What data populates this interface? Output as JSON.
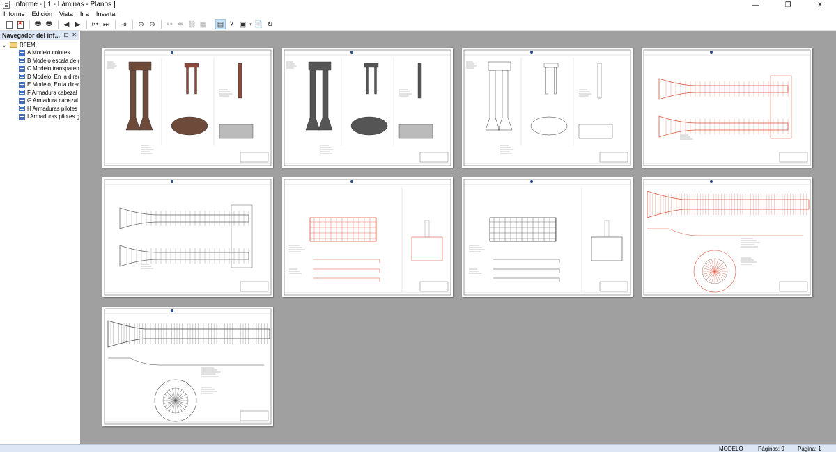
{
  "window": {
    "title": "Informe - [ 1 - Láminas - Planos ]",
    "minimize": "—",
    "maximize": "❐",
    "close": "✕"
  },
  "menu": [
    "Informe",
    "Edición",
    "Vista",
    "Ir a",
    "Insertar"
  ],
  "toolbar": {
    "icons": [
      "new-report-icon",
      "delete-report-icon",
      "print-icon",
      "print-preview-icon",
      "previous-page-icon",
      "next-page-icon",
      "first-page-icon",
      "last-page-icon",
      "go-to-page-icon",
      "zoom-in-icon",
      "zoom-out-icon",
      "single-page-icon",
      "multi-page-icon",
      "settings-icon",
      "refresh-icon"
    ]
  },
  "navigator": {
    "title": "Navegador del inf...",
    "pin": "⊡",
    "close": "✕",
    "root": "RFEM",
    "items": [
      "A Modelo colores",
      "B Modelo escala de g...",
      "C Modelo transparen...",
      "D Modelo, En la direc...",
      "E Modelo, En la direc...",
      "F Armadura cabezal",
      "G Armadura cabezal ...",
      "H Armaduras pilotes",
      "I Armaduras pilotes g..."
    ]
  },
  "pages": [
    {
      "kind": "color-model",
      "accent": "#8b4a3c"
    },
    {
      "kind": "grey-model",
      "accent": "#555555"
    },
    {
      "kind": "transparent-model",
      "accent": "#888888"
    },
    {
      "kind": "rebar-3d",
      "accent": "#d9533c"
    },
    {
      "kind": "rebar-3d",
      "accent": "#666666"
    },
    {
      "kind": "cap-rebar",
      "accent": "#d9533c"
    },
    {
      "kind": "cap-rebar",
      "accent": "#444444"
    },
    {
      "kind": "pile-rebar",
      "accent": "#d9533c"
    },
    {
      "kind": "pile-rebar",
      "accent": "#444444"
    }
  ],
  "status": {
    "mode": "MODELO",
    "pages_total": "Páginas: 9",
    "page_current": "Página: 1"
  }
}
